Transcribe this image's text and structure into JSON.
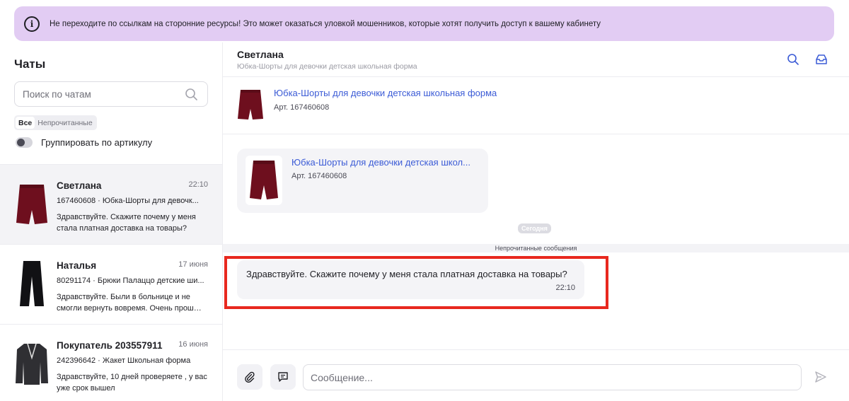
{
  "banner": {
    "text": "Не переходите по ссылкам на сторонние ресурсы! Это может оказаться уловкой мошенников, которые хотят получить доступ к вашему кабинету"
  },
  "sidebar": {
    "title": "Чаты",
    "search_placeholder": "Поиск по чатам",
    "filter_all": "Все",
    "filter_unread": "Непрочитанные",
    "group_label": "Группировать по артикулу",
    "chats": [
      {
        "name": "Светлана",
        "time": "22:10",
        "article": "167460608 · Юбка-Шорты для девочк...",
        "preview": "Здравствуйте. Скажите почему у меня стала платная доставка на товары?",
        "thumb": "skirt"
      },
      {
        "name": "Наталья",
        "time": "17 июня",
        "article": "80291174 · Брюки Палаццо детские ши...",
        "preview": "Здравствуйте. Были в больнице и не смогли вернуть вовремя. Очень прош…",
        "thumb": "trousers"
      },
      {
        "name": "Покупатель 203557911",
        "time": "16 июня",
        "article": "242396642 · Жакет Школьная форма",
        "preview": "Здравствуйте, 10 дней проверяете , у вас уже срок вышел",
        "thumb": "jacket"
      }
    ]
  },
  "chat": {
    "title": "Светлана",
    "subtitle": "Юбка-Шорты для девочки детская школьная форма",
    "product": {
      "name": "Юбка-Шорты для девочки детская школьная форма",
      "article": "Арт. 167460608"
    },
    "card": {
      "name": "Юбка-Шорты для девочки детская школ...",
      "article": "Арт. 167460608"
    },
    "date_chip": "Сегодня",
    "unread_label": "Непрочитанные сообщения",
    "message": {
      "text": "Здравствуйте. Скажите почему у меня стала платная доставка на товары?",
      "time": "22:10"
    },
    "input_placeholder": "Сообщение..."
  },
  "colors": {
    "banner_bg": "#e2ccf3",
    "link": "#3b5bd6",
    "highlight": "#e8281e",
    "product": "#6e0f1e"
  }
}
